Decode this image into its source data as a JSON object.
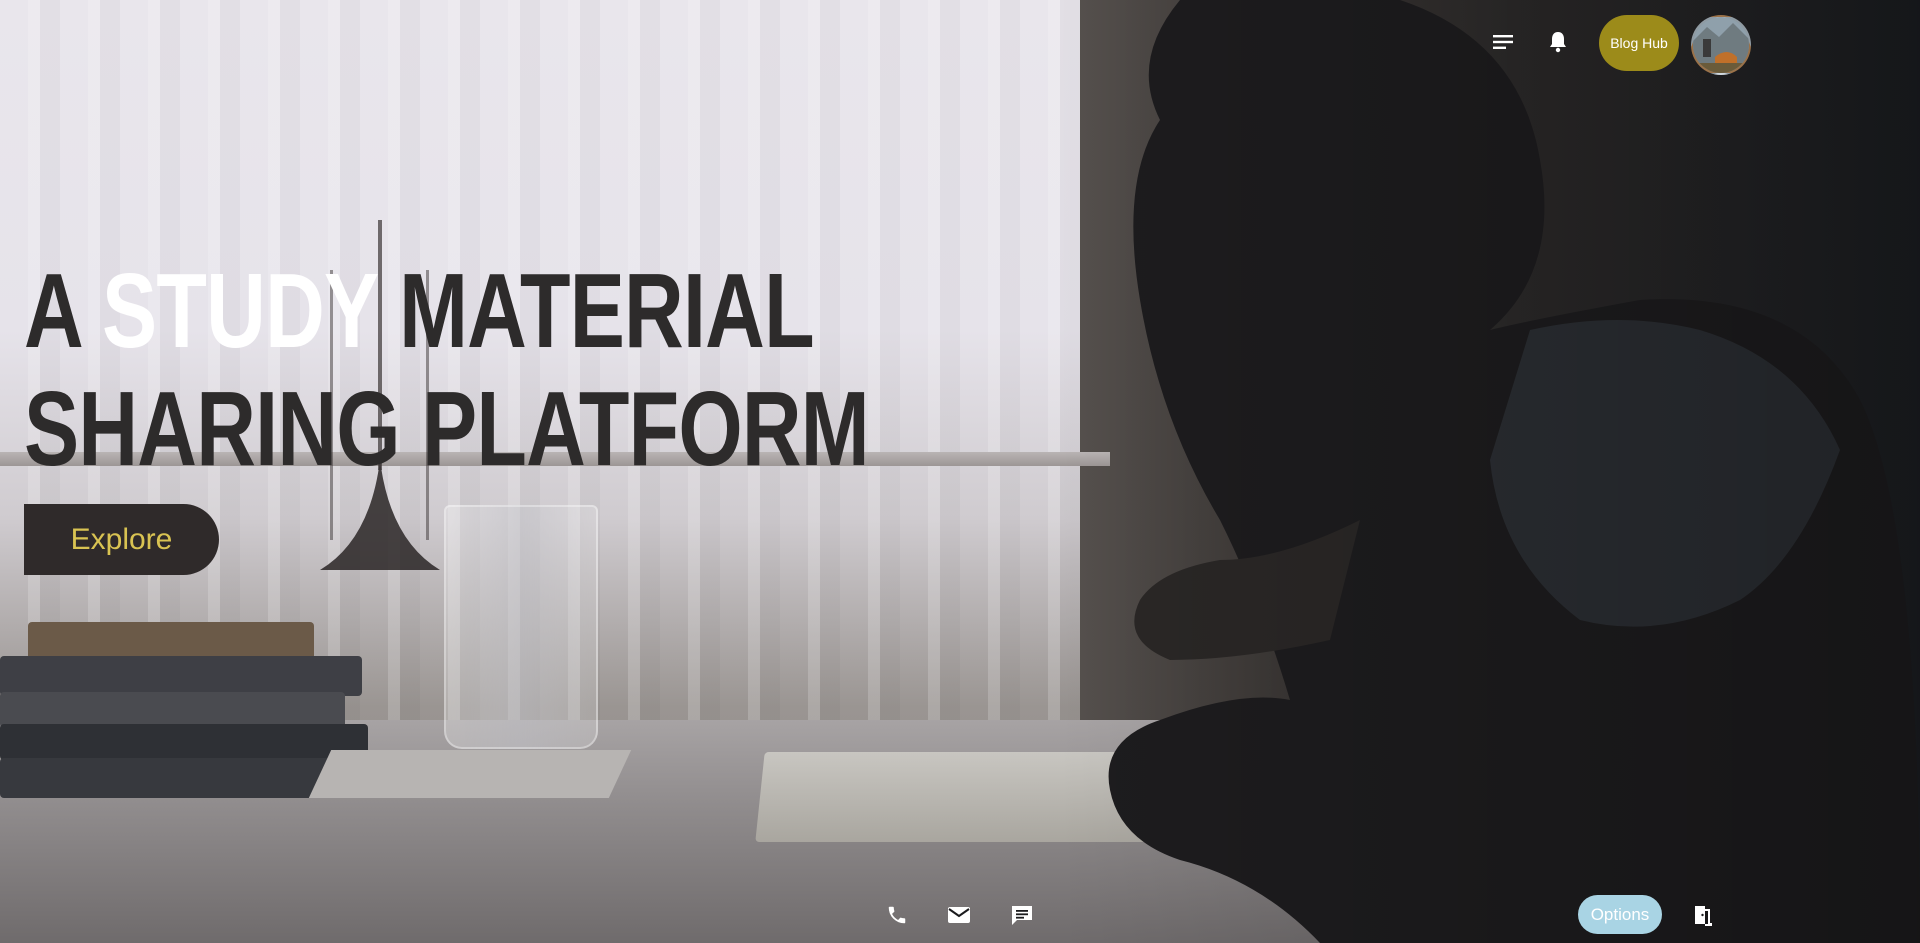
{
  "nav": {
    "menu_icon": "menu-icon",
    "notifications_icon": "bell-icon",
    "blog_hub_label": "Blog Hub",
    "avatar": "user-avatar"
  },
  "hero": {
    "title_word1": "A",
    "title_accent": "STUDY",
    "title_word3": "MATERIAL",
    "title_line2": "SHARING PLATFORM",
    "explore_label": "Explore"
  },
  "footer": {
    "phone_icon": "phone-icon",
    "mail_icon": "mail-icon",
    "chat_icon": "chat-icon",
    "options_label": "Options",
    "exit_icon": "exit-door-icon"
  },
  "colors": {
    "blog_hub_bg": "#9c8b1a",
    "explore_bg": "#2f2a2a",
    "explore_text": "#d9c352",
    "options_bg": "#a9d4e4",
    "title_dark": "#2d2b2b",
    "title_accent": "#ffffff"
  }
}
